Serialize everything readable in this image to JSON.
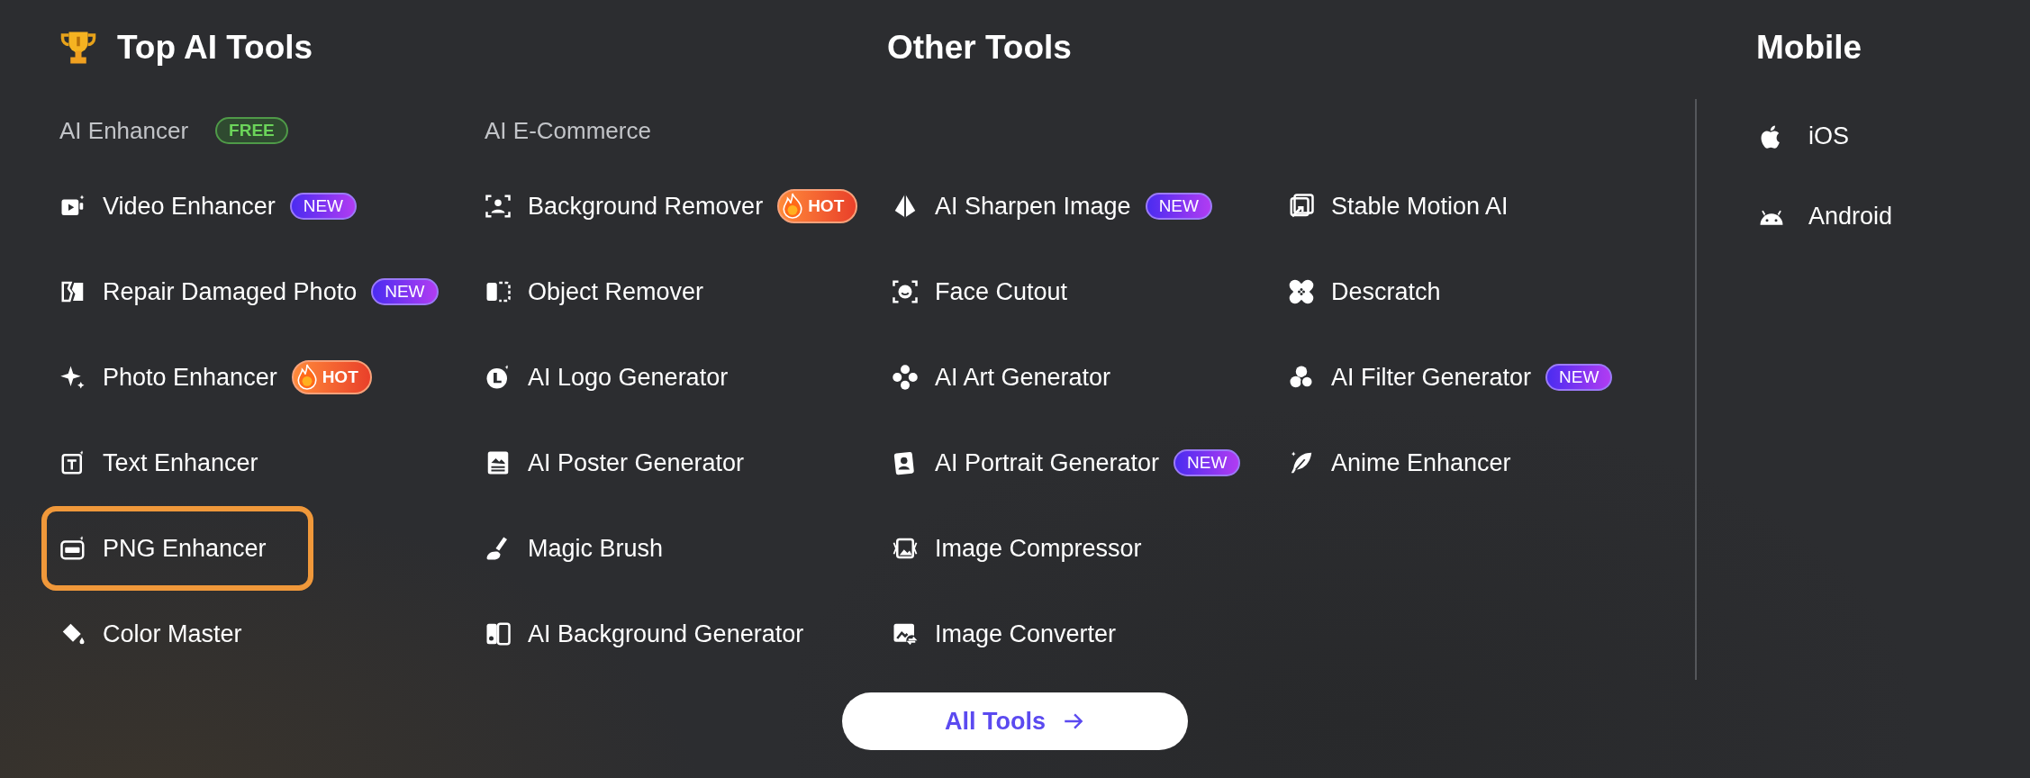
{
  "top_ai_tools": {
    "title": "Top AI Tools",
    "columns": [
      {
        "heading": "AI Enhancer",
        "heading_badge": {
          "text": "FREE",
          "kind": "free"
        },
        "items": [
          {
            "label": "Video Enhancer",
            "badge": {
              "text": "NEW",
              "kind": "new"
            },
            "highlighted": false
          },
          {
            "label": "Repair Damaged Photo",
            "badge": {
              "text": "NEW",
              "kind": "new"
            },
            "highlighted": false
          },
          {
            "label": "Photo Enhancer",
            "badge": {
              "text": "HOT",
              "kind": "hot"
            },
            "highlighted": false
          },
          {
            "label": "Text Enhancer",
            "highlighted": false
          },
          {
            "label": "PNG Enhancer",
            "highlighted": true
          },
          {
            "label": "Color Master",
            "highlighted": false
          }
        ]
      },
      {
        "heading": "AI E-Commerce",
        "items": [
          {
            "label": "Background Remover",
            "badge": {
              "text": "HOT",
              "kind": "hot"
            },
            "highlighted": false
          },
          {
            "label": "Object Remover",
            "highlighted": false
          },
          {
            "label": "AI Logo Generator",
            "highlighted": false
          },
          {
            "label": "AI Poster Generator",
            "highlighted": false
          },
          {
            "label": "Magic Brush",
            "highlighted": false
          },
          {
            "label": "AI Background Generator",
            "highlighted": false
          }
        ]
      }
    ]
  },
  "other_tools": {
    "title": "Other Tools",
    "columns": [
      {
        "items": [
          {
            "label": "AI Sharpen Image",
            "badge": {
              "text": "NEW",
              "kind": "new"
            },
            "highlighted": false
          },
          {
            "label": "Face Cutout",
            "highlighted": false
          },
          {
            "label": "AI Art Generator",
            "highlighted": false
          },
          {
            "label": "AI Portrait Generator",
            "badge": {
              "text": "NEW",
              "kind": "new"
            },
            "highlighted": false
          },
          {
            "label": "Image Compressor",
            "highlighted": false
          },
          {
            "label": "Image Converter",
            "highlighted": false
          }
        ]
      },
      {
        "items": [
          {
            "label": "Stable Motion AI",
            "highlighted": false
          },
          {
            "label": "Descratch",
            "highlighted": false
          },
          {
            "label": "AI Filter Generator",
            "badge": {
              "text": "NEW",
              "kind": "new"
            },
            "highlighted": false
          },
          {
            "label": "Anime Enhancer",
            "highlighted": false
          }
        ]
      }
    ]
  },
  "mobile": {
    "title": "Mobile",
    "items": [
      {
        "label": "iOS"
      },
      {
        "label": "Android"
      }
    ]
  },
  "all_tools_button": {
    "label": "All Tools"
  }
}
